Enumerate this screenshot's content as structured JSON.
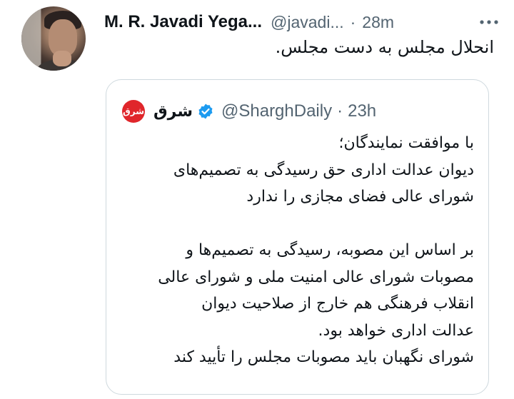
{
  "tweet": {
    "author_name": "M. R. Javadi Yega...",
    "author_handle": "@javadi...",
    "separator": "·",
    "time": "28m",
    "more_icon": "more-horizontal-icon",
    "text": "انحلال مجلس به دست مجلس."
  },
  "quoted_tweet": {
    "author_name": "شرق",
    "logo_text": "شرق",
    "verified": true,
    "verified_color": "#1d9bf0",
    "logo_color": "#e0262b",
    "author_handle": "@SharghDaily",
    "separator": "·",
    "time": "23h",
    "lines": [
      "با موافقت نمایندگان؛",
      "دیوان عدالت اداری حق رسیدگی به تصمیم‌های",
      "شورای عالی فضای مجازی را ندارد",
      "",
      "بر اساس این مصوبه، رسیدگی به تصمیم‌ها و",
      "مصوبات شورای عالی امنیت ملی و شورای عالی",
      "انقلاب فرهنگی هم خارج از صلاحیت دیوان",
      "عدالت اداری خواهد بود.",
      "شورای نگهبان باید مصوبات مجلس را تأیید کند"
    ]
  }
}
